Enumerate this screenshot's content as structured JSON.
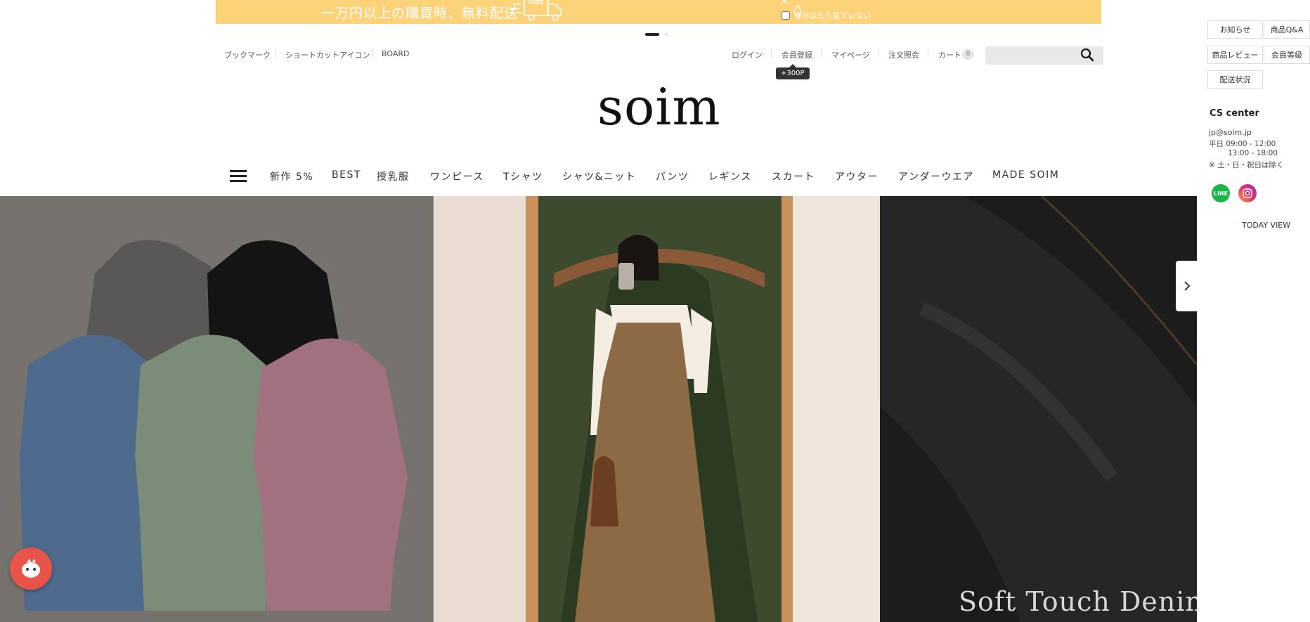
{
  "banner": {
    "text": "一万円以上の購買時、無料配送",
    "truck_label": "FREE",
    "dismiss_label": "今日はもう見ていない",
    "close_glyph": "×"
  },
  "header": {
    "left_links": [
      "ブックマーク",
      "ショートカットアイコン",
      "BOARD"
    ],
    "login": "ログイン",
    "register": "会員登録",
    "register_tooltip": "+300P",
    "mypage": "マイページ",
    "order_inquiry": "注文照会",
    "cart": "カート",
    "cart_count": "0",
    "search_placeholder": ""
  },
  "logo": "soim",
  "nav": {
    "items": [
      "新作 5%",
      "BEST",
      "授乳服",
      "ワンピース",
      "Tシャツ",
      "シャツ&ニット",
      "パンツ",
      "レギンス",
      "スカート",
      "アウター",
      "アンダーウエア",
      "MADE SOIM"
    ]
  },
  "hero": {
    "caption": "Soft Touch Denim P",
    "sweater_colors": [
      "#5a5856",
      "#141414",
      "#4e6a8c",
      "#7b8d78",
      "#a27180"
    ]
  },
  "sidebar": {
    "buttons": [
      "お知らせ",
      "商品Q&A",
      "商品レビュー",
      "会員等級",
      "配送状況"
    ],
    "cs_title": "CS center",
    "cs_email": "jp@soim.jp",
    "cs_hours1": "平日 09:00 - 12:00",
    "cs_hours2": "13:00 - 18:00",
    "cs_note": "※ 土・日・祝日は除く",
    "line_label": "LINE",
    "today_view": "TODAY VIEW"
  },
  "colors": {
    "banner": "#fdd37a",
    "chat": "#e8534a",
    "line": "#1db446",
    "instagram": "#c13584"
  },
  "icons": [
    "truck-icon",
    "search-icon",
    "hamburger-icon",
    "chevron-right-icon",
    "chat-bot-icon",
    "line-icon",
    "instagram-icon"
  ]
}
